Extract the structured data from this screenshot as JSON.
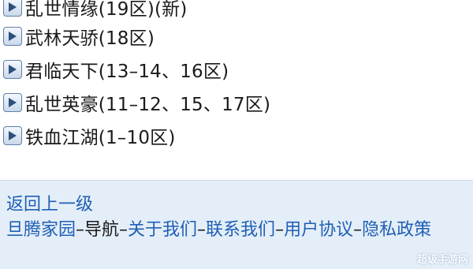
{
  "server_list": [
    {
      "label": "乱世情缘(19区)(新)"
    },
    {
      "label": "武林天骄(18区)"
    },
    {
      "label": "君临天下(13–14、16区)"
    },
    {
      "label": "乱世英豪(11–12、15、17区)"
    },
    {
      "label": "铁血江湖(1–10区)"
    }
  ],
  "footer": {
    "back_link": "返回上一级",
    "links": [
      "旦腾家园",
      "导航",
      "关于我们",
      "联系我们",
      "用户协议",
      "隐私政策"
    ],
    "separator": "–"
  },
  "watermark": "超级手游网",
  "colors": {
    "link": "#1f5fb4",
    "footer_bg": "#e4eef8",
    "arrow": "#2c4f7c"
  },
  "icons": {
    "row_bullet": "play-arrow-icon"
  }
}
